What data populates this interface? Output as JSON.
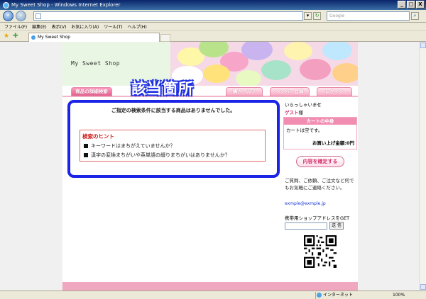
{
  "window": {
    "title": "My Sweet Shop - Windows Internet Explorer",
    "buttons": [
      "_",
      "□",
      "X"
    ]
  },
  "address_bar": {
    "url": "",
    "search_placeholder": "Google"
  },
  "menu": [
    "ファイル(F)",
    "編集(E)",
    "表示(V)",
    "お気に入り(A)",
    "ツール(T)",
    "ヘルプ(H)"
  ],
  "tab": {
    "label": "My Sweet Shop"
  },
  "status_bar": {
    "zone": "インターネット",
    "zoom": "100%"
  },
  "page": {
    "logo": "My Sweet Shop",
    "annotation": "該当箇所",
    "nav_tabs": [
      "商品の詳細検索",
      "購入ヘルプ",
      "メンバー登録",
      "ログイン"
    ],
    "main_message": "ご指定の検索条件に該当する商品はありませんでした。",
    "hint": {
      "title": "検索のヒント",
      "items": [
        "キーワードはまちがえていませんか？",
        "漢字の変換まちがいや英単語の綴りまちがいはありませんか？"
      ]
    },
    "sidebar": {
      "greeting": "いらっしゃいませ",
      "guest_name": "ゲスト",
      "guest_suffix": "様",
      "cart_title": "カートの中身",
      "cart_empty": "カートは空です。",
      "cart_total": "お買い上げ金額:0円",
      "confirm_button": "内容を確定する",
      "contact_text": "ご質問、ご依頼、ご注文など何でもお気軽にご連絡ください。",
      "email": "exmple@exmple.jp",
      "mobile_label": "携帯用ショップアドレスをGET",
      "send_button": "送 信"
    }
  },
  "colors": {
    "accent_pink": "#f28db2",
    "annotation_blue": "#1a23e6",
    "hint_red": "#d01c1c"
  }
}
